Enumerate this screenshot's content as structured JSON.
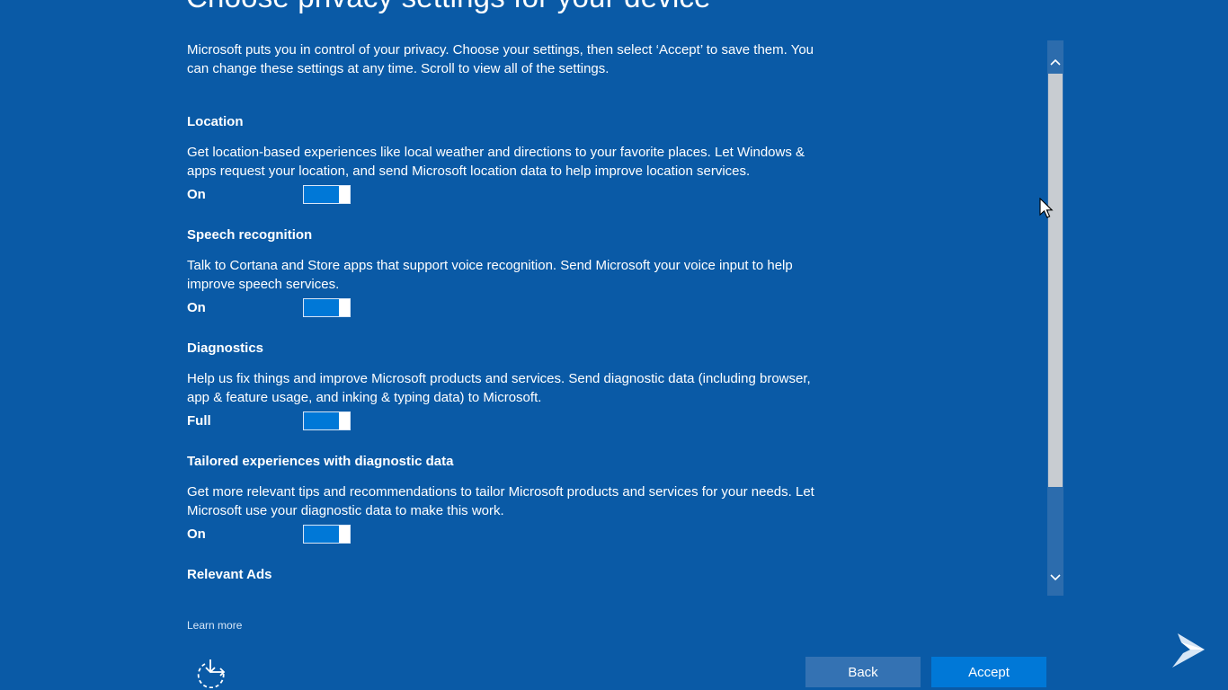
{
  "page": {
    "title": "Choose privacy settings for your device",
    "intro": "Microsoft puts you in control of your privacy. Choose your settings, then select ‘Accept’ to save them. You can change these settings at any time. Scroll to view all of the settings."
  },
  "settings": [
    {
      "title": "Location",
      "description": "Get location-based experiences like local weather and directions to your favorite places. Let Windows & apps request your location, and send Microsoft location data to help improve location services.",
      "state": "On"
    },
    {
      "title": "Speech recognition",
      "description": "Talk to Cortana and Store apps that support voice recognition. Send Microsoft your voice input to help improve speech services.",
      "state": "On"
    },
    {
      "title": "Diagnostics",
      "description": "Help us fix things and improve Microsoft products and services. Send diagnostic data (including browser, app & feature usage, and inking & typing data) to Microsoft.",
      "state": "Full"
    },
    {
      "title": "Tailored experiences with diagnostic data",
      "description": "Get more relevant tips and recommendations to tailor Microsoft products and services for your needs. Let Microsoft use your diagnostic data to make this work.",
      "state": "On"
    },
    {
      "title": "Relevant Ads"
    }
  ],
  "footer": {
    "learn_more": "Learn more",
    "back_label": "Back",
    "accept_label": "Accept",
    "accessibility_icon": "ease-of-access-icon",
    "next_icon": "chevron-right-icon"
  },
  "colors": {
    "background": "#0a5aa6",
    "toggle_on": "#0078d7",
    "accept_button": "#0078d7",
    "back_button": "#3472b3",
    "scrollbar_track": "#2c6cad",
    "scrollbar_thumb": "#c8ccd1"
  }
}
